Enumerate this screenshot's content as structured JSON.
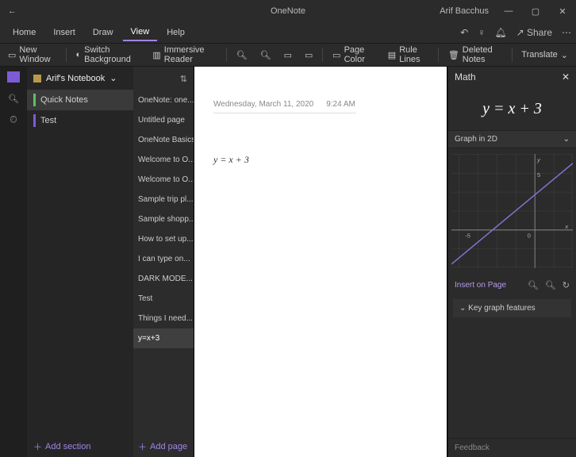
{
  "window": {
    "title": "OneNote",
    "user": "Arif Bacchus"
  },
  "tabs": {
    "home": "Home",
    "insert": "Insert",
    "draw": "Draw",
    "view": "View",
    "help": "Help"
  },
  "share": "Share",
  "ribbon": {
    "new_window": "New Window",
    "switch_bg": "Switch Background",
    "immersive": "Immersive Reader",
    "page_color": "Page Color",
    "rule_lines": "Rule Lines",
    "deleted_notes": "Deleted Notes",
    "translate": "Translate"
  },
  "notebook": {
    "name": "Arif's Notebook"
  },
  "sections": [
    {
      "label": "Quick Notes",
      "color": "#5fbf5f",
      "selected": true
    },
    {
      "label": "Test",
      "color": "#7b5cd6",
      "selected": false
    }
  ],
  "pages": [
    "OneNote: one...",
    "Untitled page",
    "OneNote Basics",
    "Welcome to O...",
    "Welcome to O...",
    "Sample trip pl...",
    "Sample shopp...",
    "How to set up...",
    "I can type on...",
    "DARK MODE...",
    "Test",
    "Things I need...",
    "y=x+3"
  ],
  "page_selected": 12,
  "canvas": {
    "date": "Wednesday, March 11, 2020",
    "time": "9:24 AM",
    "equation": "y = x + 3"
  },
  "math": {
    "title": "Math",
    "formula": "y = x + 3",
    "graph_label": "Graph in 2D",
    "insert_label": "Insert on Page",
    "kgf": "Key graph features",
    "feedback": "Feedback"
  },
  "add": {
    "section": "Add section",
    "page": "Add page"
  },
  "chart_data": {
    "type": "line",
    "title": "Graph in 2D",
    "xlabel": "x",
    "ylabel": "y",
    "xlim": [
      -6,
      6
    ],
    "ylim": [
      -6,
      6
    ],
    "series": [
      {
        "name": "y = x + 3",
        "x": [
          -6,
          -5,
          -4,
          -3,
          -2,
          -1,
          0,
          1,
          2,
          3
        ],
        "values": [
          -3,
          -2,
          -1,
          0,
          1,
          2,
          3,
          4,
          5,
          6
        ]
      }
    ],
    "xticks": [
      -5,
      0
    ],
    "yticks": [
      0,
      5
    ]
  }
}
